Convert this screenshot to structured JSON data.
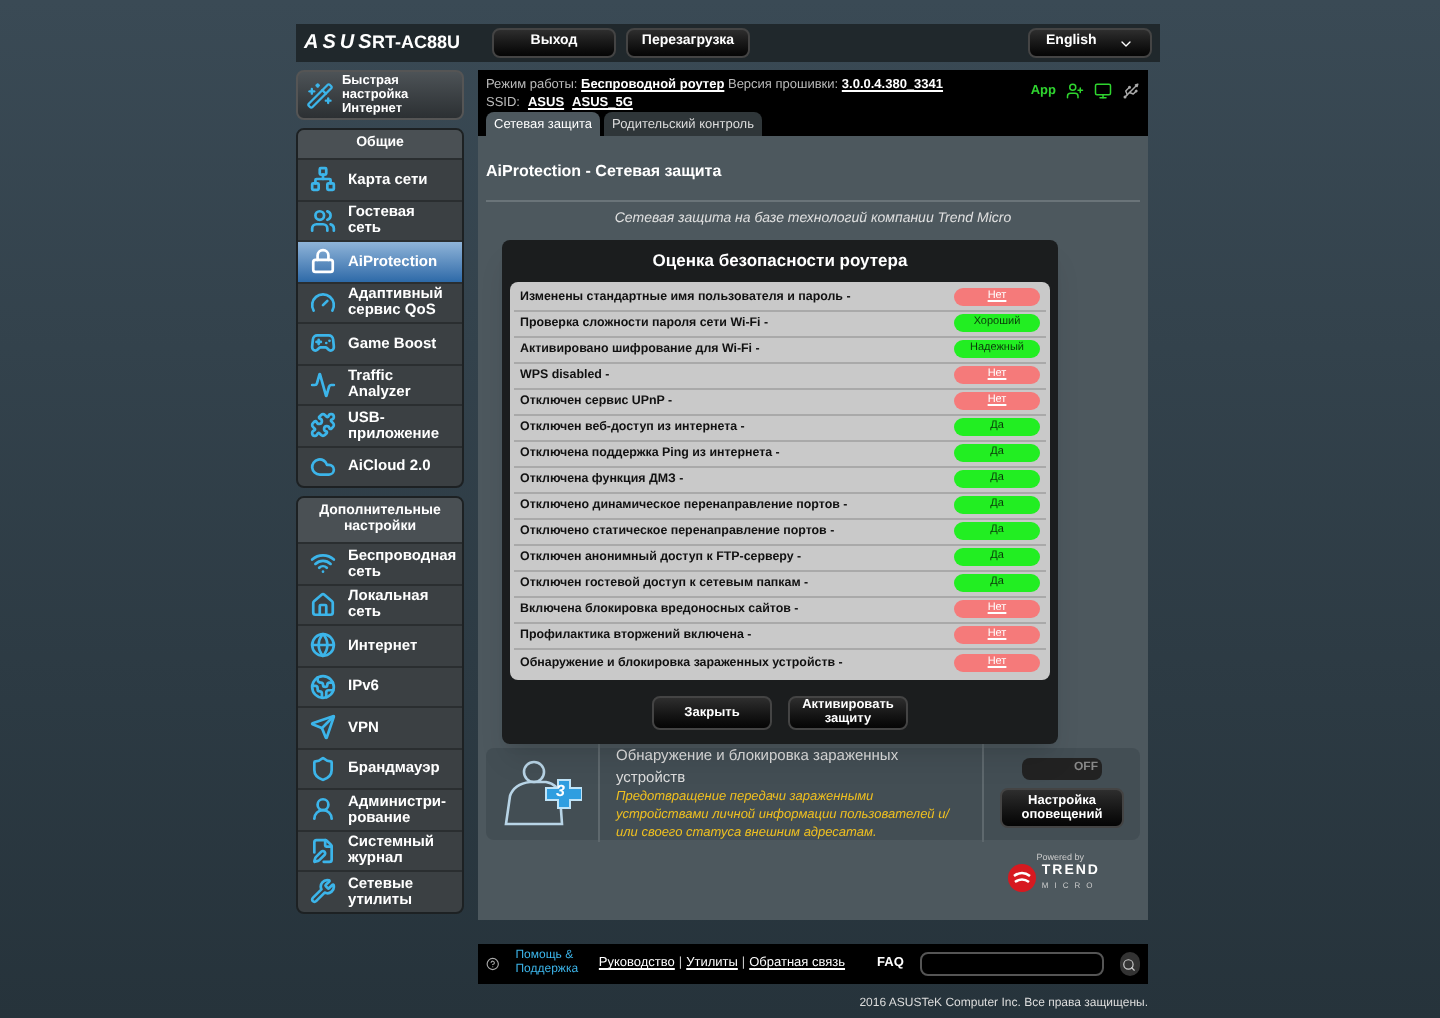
{
  "header": {
    "logo": "ASUS",
    "model": "RT-AC88U",
    "buttons": [
      "Выход",
      "Перезагрузка"
    ],
    "language": "English"
  },
  "info": {
    "mode_label": "Режим работы:",
    "mode": "Беспроводной роутер",
    "firmware_label": "Версия прошивки:",
    "firmware": "3.0.0.4.380_3341",
    "ssid_label": "SSID:",
    "ssids": [
      "ASUS",
      "ASUS_5G"
    ],
    "app": "App"
  },
  "tabs": [
    {
      "label": "Сетевая защита",
      "selected": true
    },
    {
      "label": "Родительский контроль",
      "selected": false
    }
  ],
  "sidebar": {
    "quick_setup": "Быстрая настройка Интернет",
    "sections": [
      {
        "title": "Общие",
        "items": [
          {
            "label": "Карта сети",
            "selected": false
          },
          {
            "label": "Гостевая сеть",
            "selected": false
          },
          {
            "label": "AiProtection",
            "selected": true
          },
          {
            "label": "Адаптивный сервис QoS",
            "selected": false
          },
          {
            "label": "Game Boost",
            "selected": false
          },
          {
            "label": "Traffic Analyzer",
            "selected": false
          },
          {
            "label": "USB-приложение",
            "selected": false
          },
          {
            "label": "AiCloud 2.0",
            "selected": false
          }
        ]
      },
      {
        "title": "Дополнительные настройки",
        "items": [
          {
            "label": "Беспроводная сеть",
            "selected": false
          },
          {
            "label": "Локальная сеть",
            "selected": false
          },
          {
            "label": "Интернет",
            "selected": false
          },
          {
            "label": "IPv6",
            "selected": false
          },
          {
            "label": "VPN",
            "selected": false
          },
          {
            "label": "Брандмауэр",
            "selected": false
          },
          {
            "label": "Администри-рование",
            "selected": false
          },
          {
            "label": "Системный журнал",
            "selected": false
          },
          {
            "label": "Сетевые утилиты",
            "selected": false
          }
        ]
      }
    ]
  },
  "main": {
    "title": "AiProtection - Сетевая защита",
    "intro": "Сетевая защита на базе технологий компании Trend Micro",
    "card": {
      "title": "Обнаружение и блокировка зараженных устройств",
      "description": "Предотвращение передачи зараженными устройствами личной информации пользователей и/или своего статуса внешним адресатам.",
      "badge": "3",
      "toggle": {
        "label": "OFF",
        "on": false
      },
      "button": "Настройка оповещений"
    },
    "powered": {
      "label": "Powered by",
      "brand": "TREND",
      "sub": "MICRO"
    }
  },
  "modal": {
    "title": "Оценка безопасности роутера",
    "rows": [
      {
        "label": "Изменены стандартные имя пользователя и пароль -",
        "value": "Нет",
        "passed": false
      },
      {
        "label": "Проверка сложности пароля сети Wi-Fi -",
        "value": "Хороший",
        "passed": true
      },
      {
        "label": "Активировано шифрование для Wi-Fi -",
        "value": "Надежный",
        "passed": true
      },
      {
        "label": "WPS disabled -",
        "value": "Нет",
        "passed": false
      },
      {
        "label": "Отключен сервис UPnP -",
        "value": "Нет",
        "passed": false
      },
      {
        "label": "Отключен веб-доступ из интернета -",
        "value": "Да",
        "passed": true
      },
      {
        "label": "Отключена поддержка Ping из интернета -",
        "value": "Да",
        "passed": true
      },
      {
        "label": "Отключена функция ДМЗ -",
        "value": "Да",
        "passed": true
      },
      {
        "label": "Отключено динамическое перенаправление портов -",
        "value": "Да",
        "passed": true
      },
      {
        "label": "Отключено статическое перенаправление портов -",
        "value": "Да",
        "passed": true
      },
      {
        "label": "Отключен анонимный доступ к FTP-серверу -",
        "value": "Да",
        "passed": true
      },
      {
        "label": "Отключен гостевой доступ к сетевым папкам -",
        "value": "Да",
        "passed": true
      },
      {
        "label": "Включена блокировка вредоносных сайтов -",
        "value": "Нет",
        "passed": false
      },
      {
        "label": "Профилактика вторжений включена -",
        "value": "Нет",
        "passed": false
      },
      {
        "label": "Обнаружение и блокировка зараженных устройств -",
        "value": "Нет",
        "passed": false
      }
    ],
    "buttons": [
      "Закрыть",
      "Активировать защиту"
    ]
  },
  "footer": {
    "help": "Помощь & Поддержка",
    "links": [
      "Руководство",
      "Утилиты",
      "Обратная связь"
    ],
    "separator": "|",
    "faq": "FAQ",
    "copyright": "2016 ASUSTeK Computer Inc. Все права защищены."
  }
}
